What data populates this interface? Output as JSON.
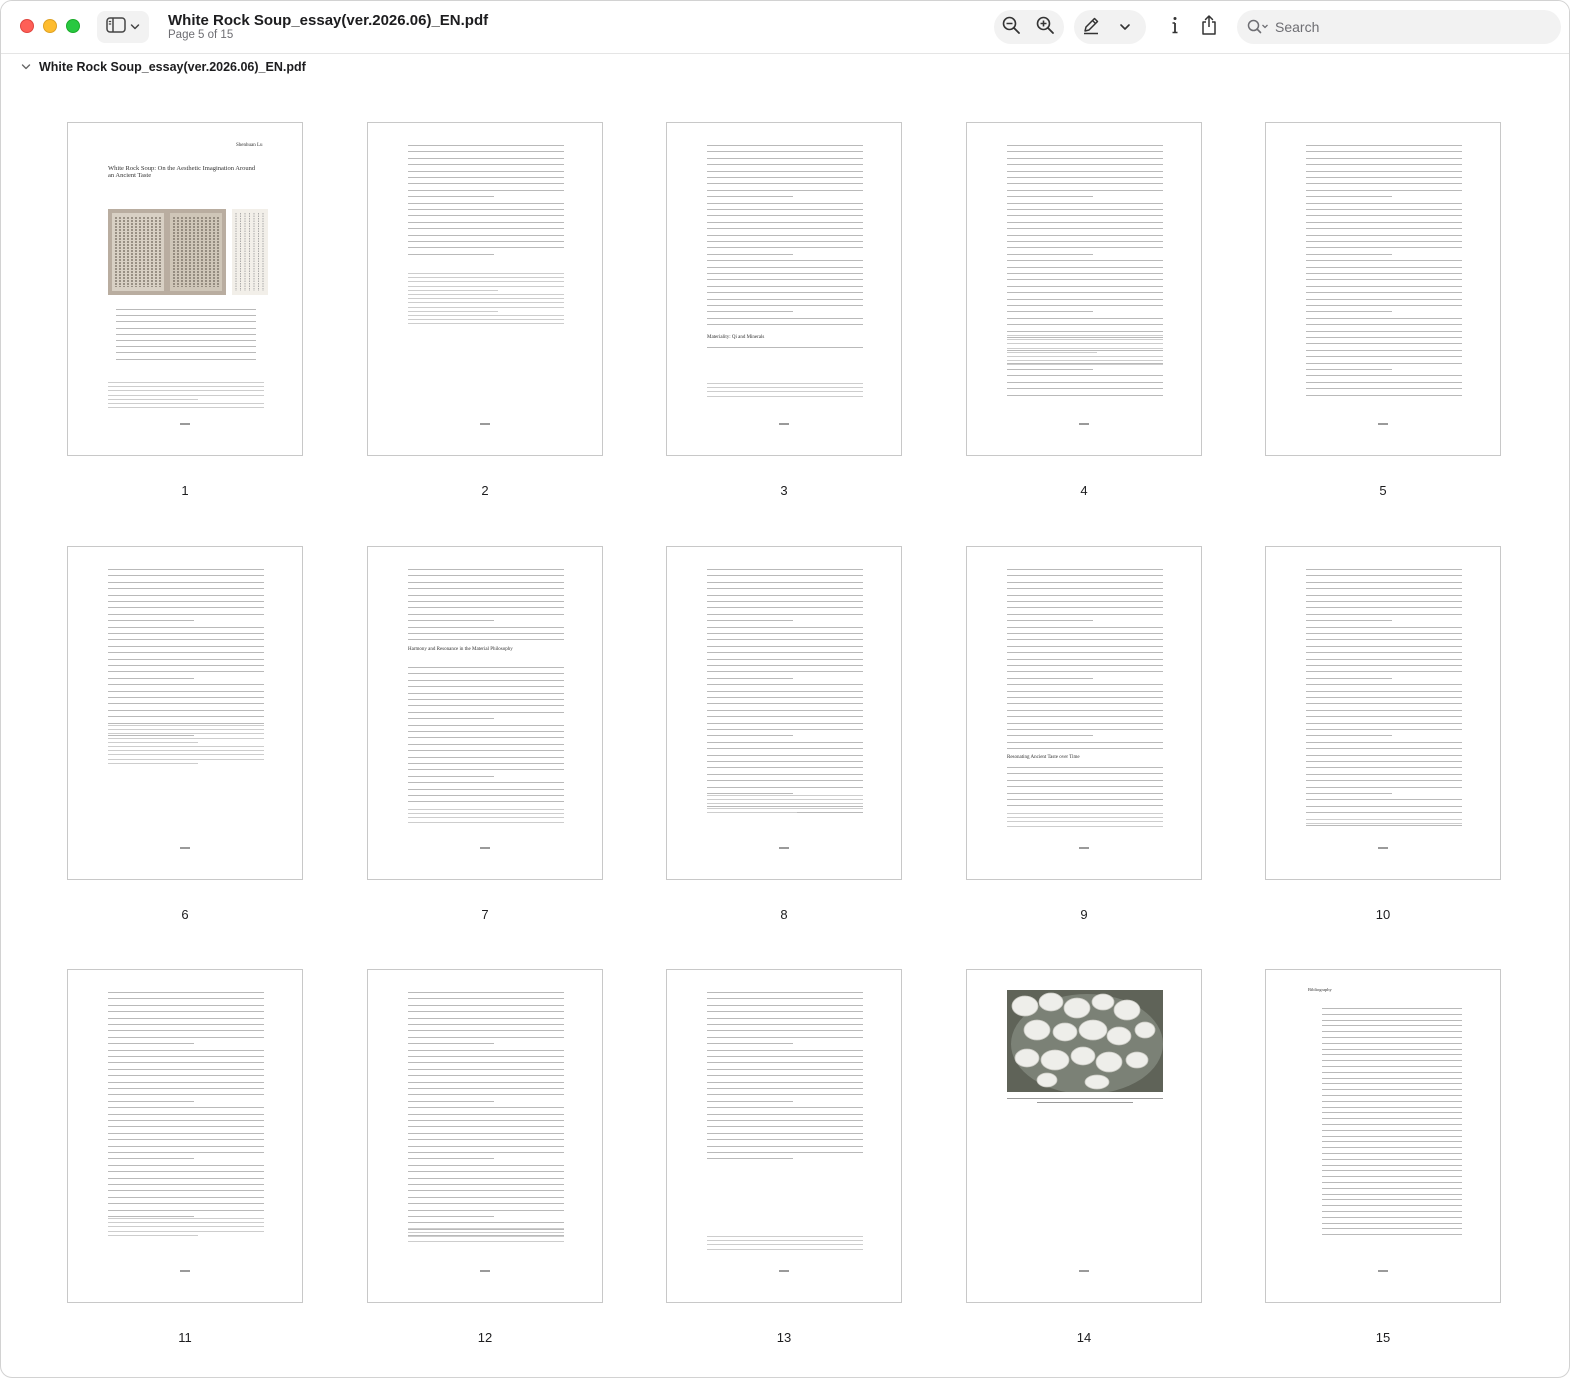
{
  "window": {
    "title": "White Rock Soup_essay(ver.2026.06)_EN.pdf",
    "subtitle": "Page 5 of 15"
  },
  "toolbar": {
    "sidebar_icon": "sidebar-icon",
    "zoom_out_icon": "zoom-out-icon",
    "zoom_in_icon": "zoom-in-icon",
    "markup_icon": "pencil-icon",
    "markup_menu_icon": "chevron-down-icon",
    "info_icon": "info-icon",
    "share_icon": "share-icon",
    "search_placeholder": "Search"
  },
  "breadcrumb": {
    "label": "White Rock Soup_essay(ver.2026.06)_EN.pdf"
  },
  "pages": [
    {
      "label": "1",
      "header": "Shenhuan Lu",
      "heading": "White Rock Soup: On the Aesthetic Imagination Around an Ancient Taste"
    },
    {
      "label": "2"
    },
    {
      "label": "3",
      "section": "Materiality: Qi and Minerals"
    },
    {
      "label": "4"
    },
    {
      "label": "5"
    },
    {
      "label": "6"
    },
    {
      "label": "7",
      "section": "Harmony and Resonance in the Material Philosophy"
    },
    {
      "label": "8"
    },
    {
      "label": "9",
      "section": "Resonating Ancient Taste over Time"
    },
    {
      "label": "10"
    },
    {
      "label": "11"
    },
    {
      "label": "12"
    },
    {
      "label": "13"
    },
    {
      "label": "14"
    },
    {
      "label": "15",
      "section": "Bibliography"
    }
  ],
  "colors": {
    "accent": "#007aff",
    "red": "#fe5f57",
    "yellow": "#febc2e",
    "green": "#28c840"
  }
}
